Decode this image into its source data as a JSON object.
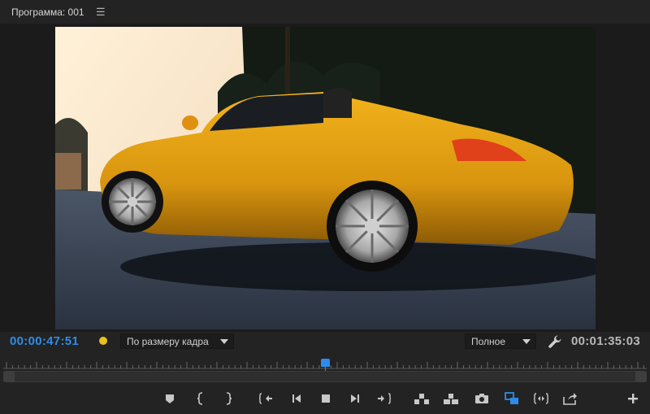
{
  "panel": {
    "title": "Программа: 001",
    "menu_icon": "hamburger-icon"
  },
  "viewer": {
    "image_subject": "yellow convertible sports car photo"
  },
  "controls": {
    "current_timecode": "00:00:47:51",
    "duration_timecode": "00:01:35:03",
    "zoom_select": "По размеру кадра",
    "quality_select": "Полное",
    "marker_color": "#e8c21c",
    "settings_icon": "wrench-icon"
  },
  "timeline": {
    "playhead_color": "#2d8ceb"
  },
  "transport": {
    "buttons": [
      "add-marker-icon",
      "mark-in-icon",
      "mark-out-icon",
      "go-to-in-icon",
      "step-back-icon",
      "stop-icon",
      "step-forward-icon",
      "go-to-out-icon",
      "lift-icon",
      "extract-icon",
      "export-frame-icon",
      "compare-view-icon",
      "trim-icon",
      "export-icon",
      "add-button-icon"
    ],
    "active_color": "#2d8ceb"
  }
}
